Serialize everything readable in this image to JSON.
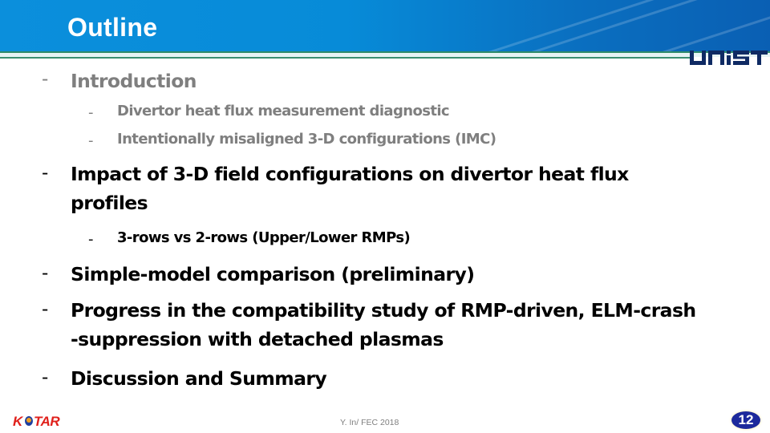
{
  "header": {
    "title": "Outline",
    "logo": "UNIST"
  },
  "outline": [
    {
      "level": 1,
      "bullet": "-",
      "text": "Introduction",
      "state": "inactive"
    },
    {
      "level": 2,
      "bullet": "-",
      "text": "Divertor heat flux measurement diagnostic",
      "state": "inactive"
    },
    {
      "level": 2,
      "bullet": "-",
      "text": "Intentionally misaligned 3-D configurations (IMC)",
      "state": "inactive"
    },
    {
      "level": 1,
      "bullet": "-",
      "text_line1": "Impact of 3-D field configurations on divertor heat flux",
      "text_line2": "profiles",
      "state": "active"
    },
    {
      "level": 2,
      "bullet": "-",
      "text": "3-rows vs 2-rows (Upper/Lower RMPs)",
      "state": "active"
    },
    {
      "level": 1,
      "bullet": "-",
      "text": "Simple-model comparison (preliminary)",
      "state": "active"
    },
    {
      "level": 1,
      "bullet": "-",
      "text_line1": "Progress in the compatibility study of RMP-driven, ELM-crash",
      "text_line2": "-suppression with detached plasmas",
      "state": "active"
    },
    {
      "level": 1,
      "bullet": "-",
      "text": "Discussion and Summary",
      "state": "active"
    }
  ],
  "footer": {
    "logo": "KSTAR",
    "credit": "Y. In/ FEC 2018",
    "page_number": "12"
  },
  "colors": {
    "header_blue": "#078bd8",
    "inactive_text": "#7f7f7f",
    "active_text": "#000000",
    "page_badge": "#1d2a9c",
    "kstar_red": "#e0201b",
    "unist_navy": "#0f2a63"
  }
}
